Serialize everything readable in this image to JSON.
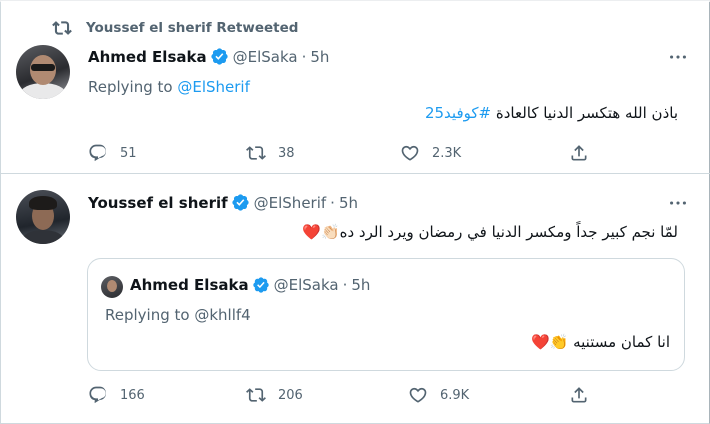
{
  "retweet": {
    "label": "Youssef el sherif Retweeted"
  },
  "tweet1": {
    "name": "Ahmed Elsaka",
    "handle": "@ElSaka",
    "dot": "·",
    "time": "5h",
    "replying_prefix": "Replying to ",
    "replying_handle": "@ElSherif",
    "text_main": "باذن الله هتكسر الدنيا كالعادة ",
    "text_hashtag": "#كوفيد25",
    "actions": {
      "replies": "51",
      "retweets": "38",
      "likes": "2.3K"
    }
  },
  "tweet2": {
    "name": "Youssef el sherif",
    "handle": "@ElSherif",
    "dot": "·",
    "time": "5h",
    "text": "لمّا نجم كبير جداً ومكسر الدنيا في رمضان ويرد الرد ده👏🏻❤️",
    "quote": {
      "name": "Ahmed Elsaka",
      "handle": "@ElSaka",
      "dot": "·",
      "time": "5h",
      "replying": "Replying to @khllf4",
      "text": "انا كمان مستنيه 👏❤️"
    },
    "actions": {
      "replies": "166",
      "retweets": "206",
      "likes": "6.9K"
    }
  },
  "colors": {
    "accent": "#1d9bf0",
    "secondary_text": "#536471",
    "primary_text": "#0f1419",
    "border": "#cfd9de"
  },
  "icons": [
    "retweet-icon",
    "verified-icon",
    "more-icon",
    "reply-icon",
    "like-icon",
    "share-icon"
  ]
}
